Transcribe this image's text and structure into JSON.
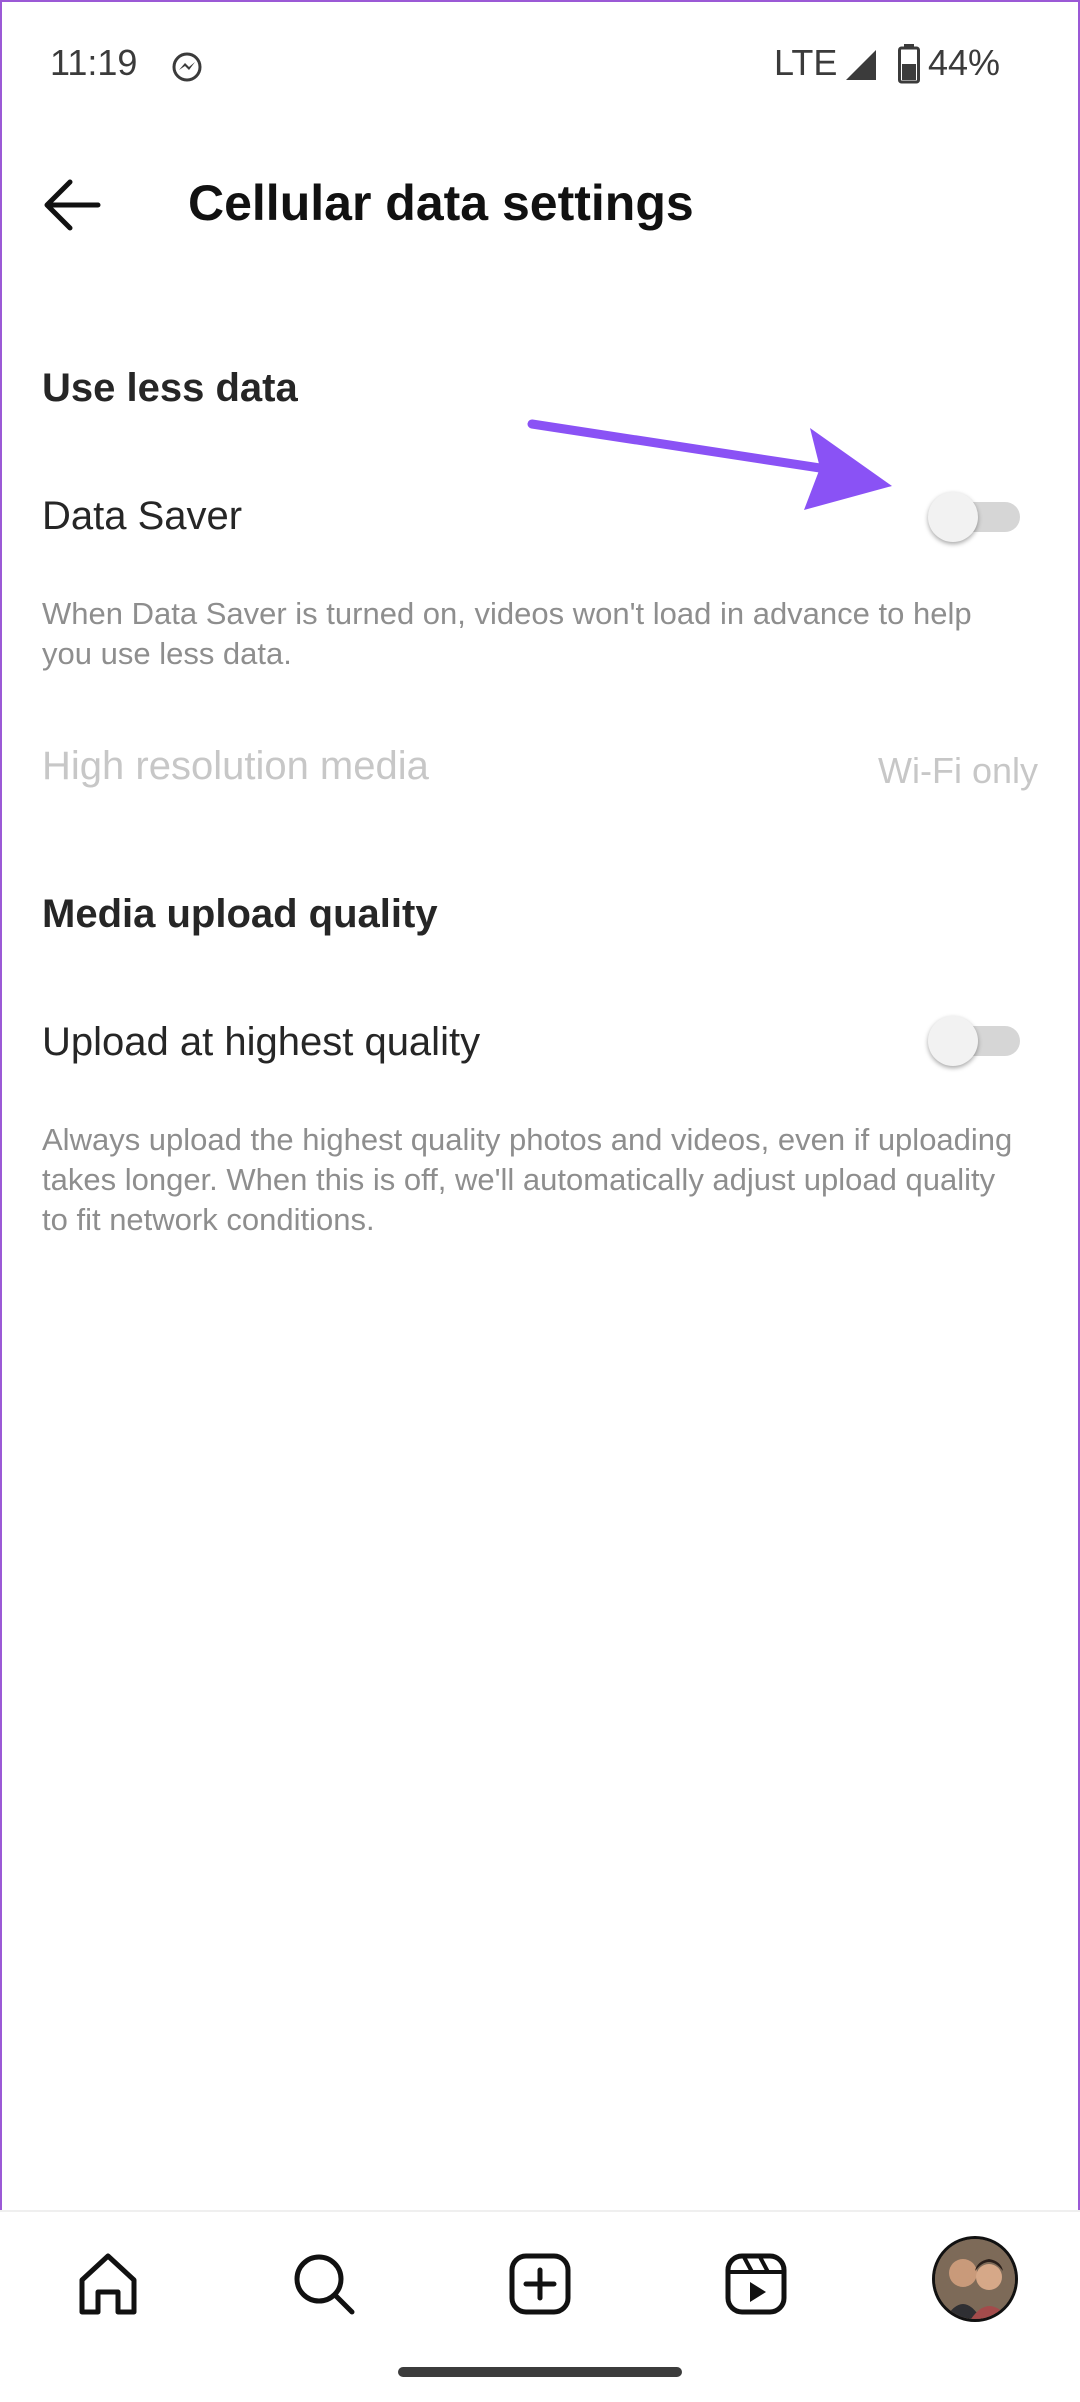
{
  "status_bar": {
    "time": "11:19",
    "app_icon": "messenger-icon",
    "network": "LTE",
    "signal_icon": "signal-icon",
    "battery_icon": "battery-icon",
    "battery_percent": "44%"
  },
  "header": {
    "back_icon": "arrow-left-icon",
    "title": "Cellular data settings"
  },
  "sections": {
    "use_less_data": {
      "heading": "Use less data",
      "data_saver": {
        "label": "Data Saver",
        "toggle_on": false,
        "description": "When Data Saver is turned on, videos won't load in advance to help you use less data."
      },
      "high_resolution": {
        "label": "High resolution media",
        "value": "Wi-Fi only"
      }
    },
    "media_upload_quality": {
      "heading": "Media upload quality",
      "upload_highest": {
        "label": "Upload at highest quality",
        "toggle_on": false,
        "description": "Always upload the highest quality photos and videos, even if uploading takes longer. When this is off, we'll automatically adjust upload quality to fit network conditions."
      }
    }
  },
  "annotation": {
    "arrow_color": "#8a52f5"
  },
  "bottom_nav": {
    "items": [
      "home-icon",
      "search-icon",
      "create-icon",
      "reels-icon",
      "profile-avatar"
    ]
  },
  "colors": {
    "text_primary": "#262626",
    "text_secondary": "#8e8e8e",
    "text_disabled": "#c7c7c7",
    "toggle_track": "#d6d6d6"
  }
}
